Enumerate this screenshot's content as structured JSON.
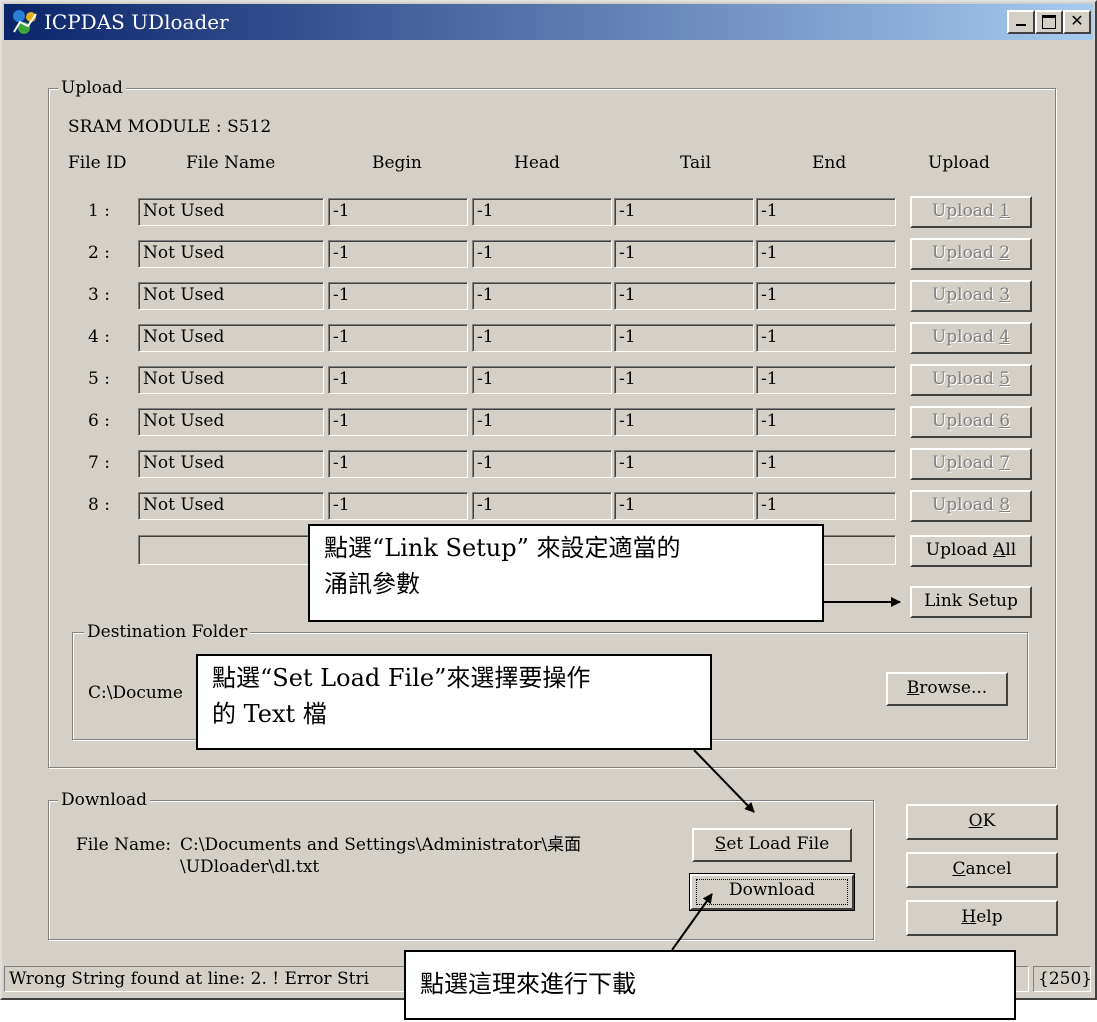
{
  "window": {
    "title": "ICPDAS UDloader"
  },
  "upload": {
    "group_label": "Upload",
    "module_label": "SRAM MODULE : S512",
    "headers": {
      "file_id": "File ID",
      "file_name": "File Name",
      "begin": "Begin",
      "head": "Head",
      "tail": "Tail",
      "end": "End",
      "upload": "Upload"
    },
    "rows": [
      {
        "id": "1 :",
        "name": "Not Used",
        "begin": "-1",
        "head": "-1",
        "tail": "-1",
        "end": "-1",
        "btn": "Upload ",
        "key": "1"
      },
      {
        "id": "2 :",
        "name": "Not Used",
        "begin": "-1",
        "head": "-1",
        "tail": "-1",
        "end": "-1",
        "btn": "Upload ",
        "key": "2"
      },
      {
        "id": "3 :",
        "name": "Not Used",
        "begin": "-1",
        "head": "-1",
        "tail": "-1",
        "end": "-1",
        "btn": "Upload ",
        "key": "3"
      },
      {
        "id": "4 :",
        "name": "Not Used",
        "begin": "-1",
        "head": "-1",
        "tail": "-1",
        "end": "-1",
        "btn": "Upload ",
        "key": "4"
      },
      {
        "id": "5 :",
        "name": "Not Used",
        "begin": "-1",
        "head": "-1",
        "tail": "-1",
        "end": "-1",
        "btn": "Upload ",
        "key": "5"
      },
      {
        "id": "6 :",
        "name": "Not Used",
        "begin": "-1",
        "head": "-1",
        "tail": "-1",
        "end": "-1",
        "btn": "Upload ",
        "key": "6"
      },
      {
        "id": "7 :",
        "name": "Not Used",
        "begin": "-1",
        "head": "-1",
        "tail": "-1",
        "end": "-1",
        "btn": "Upload ",
        "key": "7"
      },
      {
        "id": "8 :",
        "name": "Not Used",
        "begin": "-1",
        "head": "-1",
        "tail": "-1",
        "end": "-1",
        "btn": "Upload ",
        "key": "8"
      }
    ],
    "upload_all": {
      "pre": "Upload ",
      "key": "A",
      "post": "ll"
    },
    "link_setup": "Link Setup",
    "destination": {
      "group_label": "Destination Folder",
      "path": "C:\\Docume",
      "browse": {
        "key": "B",
        "post": "rowse..."
      }
    }
  },
  "download": {
    "group_label": "Download",
    "file_name_label": "File Name:",
    "file_path_line1": "C:\\Documents and Settings\\Administrator\\桌面",
    "file_path_line2": "\\UDloader\\dl.txt",
    "set_load_file": {
      "key": "S",
      "post": "et Load File"
    },
    "download_btn": "Download"
  },
  "dialog_buttons": {
    "ok": {
      "key": "O",
      "post": "K"
    },
    "cancel": {
      "key": "C",
      "post": "ancel"
    },
    "help": {
      "key": "H",
      "post": "elp"
    }
  },
  "status": {
    "message": "Wrong String found at line: 2. ! Error Stri",
    "count": "{250}"
  },
  "callouts": {
    "link_setup_line1": "點選“Link Setup” 來設定適當的",
    "link_setup_line2": "涌訊參數",
    "set_load_line1": "點選“Set Load File”來選擇要操作",
    "set_load_line2": "的 Text 檔",
    "download": "點選這理來進行下載"
  },
  "colors": {
    "titlebar_start": "#0a246a",
    "titlebar_end": "#a6caf0",
    "face": "#d4d0c8"
  }
}
